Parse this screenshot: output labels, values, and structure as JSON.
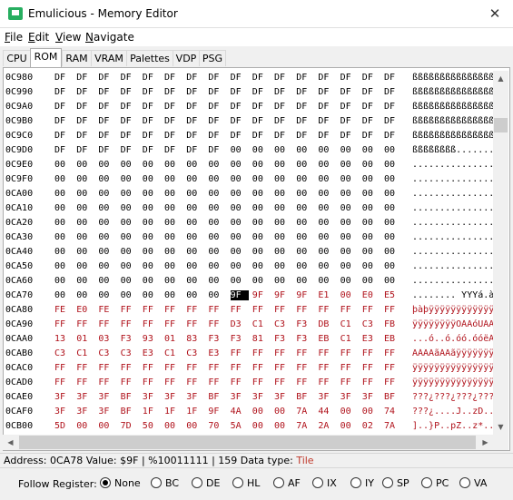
{
  "window": {
    "title": "Emulicious - Memory Editor",
    "close_glyph": "✕"
  },
  "menu": [
    "File",
    "Edit",
    "View",
    "Navigate"
  ],
  "tabs": [
    "CPU",
    "ROM",
    "RAM",
    "VRAM",
    "Palettes",
    "VDP",
    "PSG"
  ],
  "active_tab": "ROM",
  "colors": {
    "modified_byte": "#b0121b",
    "selection": "#000000",
    "accent": "#27ae60"
  },
  "memory": {
    "rows": [
      {
        "addr": "0C980",
        "bytes": [
          "DF",
          "DF",
          "DF",
          "DF",
          "DF",
          "DF",
          "DF",
          "DF",
          "DF",
          "DF",
          "DF",
          "DF",
          "DF",
          "DF",
          "DF",
          "DF"
        ],
        "ascii": "ßßßßßßßßßßßßßßßß",
        "red": false
      },
      {
        "addr": "0C990",
        "bytes": [
          "DF",
          "DF",
          "DF",
          "DF",
          "DF",
          "DF",
          "DF",
          "DF",
          "DF",
          "DF",
          "DF",
          "DF",
          "DF",
          "DF",
          "DF",
          "DF"
        ],
        "ascii": "ßßßßßßßßßßßßßßßß",
        "red": false
      },
      {
        "addr": "0C9A0",
        "bytes": [
          "DF",
          "DF",
          "DF",
          "DF",
          "DF",
          "DF",
          "DF",
          "DF",
          "DF",
          "DF",
          "DF",
          "DF",
          "DF",
          "DF",
          "DF",
          "DF"
        ],
        "ascii": "ßßßßßßßßßßßßßßßß",
        "red": false
      },
      {
        "addr": "0C9B0",
        "bytes": [
          "DF",
          "DF",
          "DF",
          "DF",
          "DF",
          "DF",
          "DF",
          "DF",
          "DF",
          "DF",
          "DF",
          "DF",
          "DF",
          "DF",
          "DF",
          "DF"
        ],
        "ascii": "ßßßßßßßßßßßßßßßß",
        "red": false
      },
      {
        "addr": "0C9C0",
        "bytes": [
          "DF",
          "DF",
          "DF",
          "DF",
          "DF",
          "DF",
          "DF",
          "DF",
          "DF",
          "DF",
          "DF",
          "DF",
          "DF",
          "DF",
          "DF",
          "DF"
        ],
        "ascii": "ßßßßßßßßßßßßßßßß",
        "red": false
      },
      {
        "addr": "0C9D0",
        "bytes": [
          "DF",
          "DF",
          "DF",
          "DF",
          "DF",
          "DF",
          "DF",
          "DF",
          "00",
          "00",
          "00",
          "00",
          "00",
          "00",
          "00",
          "00"
        ],
        "ascii": "ßßßßßßßß........",
        "red": false
      },
      {
        "addr": "0C9E0",
        "bytes": [
          "00",
          "00",
          "00",
          "00",
          "00",
          "00",
          "00",
          "00",
          "00",
          "00",
          "00",
          "00",
          "00",
          "00",
          "00",
          "00"
        ],
        "ascii": "................",
        "red": false
      },
      {
        "addr": "0C9F0",
        "bytes": [
          "00",
          "00",
          "00",
          "00",
          "00",
          "00",
          "00",
          "00",
          "00",
          "00",
          "00",
          "00",
          "00",
          "00",
          "00",
          "00"
        ],
        "ascii": "................",
        "red": false
      },
      {
        "addr": "0CA00",
        "bytes": [
          "00",
          "00",
          "00",
          "00",
          "00",
          "00",
          "00",
          "00",
          "00",
          "00",
          "00",
          "00",
          "00",
          "00",
          "00",
          "00"
        ],
        "ascii": "................",
        "red": false
      },
      {
        "addr": "0CA10",
        "bytes": [
          "00",
          "00",
          "00",
          "00",
          "00",
          "00",
          "00",
          "00",
          "00",
          "00",
          "00",
          "00",
          "00",
          "00",
          "00",
          "00"
        ],
        "ascii": "................",
        "red": false
      },
      {
        "addr": "0CA20",
        "bytes": [
          "00",
          "00",
          "00",
          "00",
          "00",
          "00",
          "00",
          "00",
          "00",
          "00",
          "00",
          "00",
          "00",
          "00",
          "00",
          "00"
        ],
        "ascii": "................",
        "red": false
      },
      {
        "addr": "0CA30",
        "bytes": [
          "00",
          "00",
          "00",
          "00",
          "00",
          "00",
          "00",
          "00",
          "00",
          "00",
          "00",
          "00",
          "00",
          "00",
          "00",
          "00"
        ],
        "ascii": "................",
        "red": false
      },
      {
        "addr": "0CA40",
        "bytes": [
          "00",
          "00",
          "00",
          "00",
          "00",
          "00",
          "00",
          "00",
          "00",
          "00",
          "00",
          "00",
          "00",
          "00",
          "00",
          "00"
        ],
        "ascii": "................",
        "red": false
      },
      {
        "addr": "0CA50",
        "bytes": [
          "00",
          "00",
          "00",
          "00",
          "00",
          "00",
          "00",
          "00",
          "00",
          "00",
          "00",
          "00",
          "00",
          "00",
          "00",
          "00"
        ],
        "ascii": "................",
        "red": false
      },
      {
        "addr": "0CA60",
        "bytes": [
          "00",
          "00",
          "00",
          "00",
          "00",
          "00",
          "00",
          "00",
          "00",
          "00",
          "00",
          "00",
          "00",
          "00",
          "00",
          "00"
        ],
        "ascii": "................",
        "red": false
      },
      {
        "addr": "0CA70",
        "bytes": [
          "00",
          "00",
          "00",
          "00",
          "00",
          "00",
          "00",
          "00",
          "9F",
          "9F",
          "9F",
          "9F",
          "E1",
          "00",
          "E0",
          "E5"
        ],
        "ascii": "........ ŸŸŸá.àå",
        "red": false,
        "red_from": 8,
        "sel_index": 8
      },
      {
        "addr": "0CA80",
        "bytes": [
          "FE",
          "E0",
          "FE",
          "FF",
          "FF",
          "FF",
          "FF",
          "FF",
          "FF",
          "FF",
          "FF",
          "FF",
          "FF",
          "FF",
          "FF",
          "FF"
        ],
        "ascii": "þàþÿÿÿÿÿÿÿÿÿÿÿÿÿ",
        "red": true
      },
      {
        "addr": "0CA90",
        "bytes": [
          "FF",
          "FF",
          "FF",
          "FF",
          "FF",
          "FF",
          "FF",
          "FF",
          "D3",
          "C1",
          "C3",
          "F3",
          "DB",
          "C1",
          "C3",
          "FB"
        ],
        "ascii": "ÿÿÿÿÿÿÿÿÓÁÃóÛÁÃû",
        "red": true
      },
      {
        "addr": "0CAA0",
        "bytes": [
          "13",
          "01",
          "03",
          "F3",
          "93",
          "01",
          "83",
          "F3",
          "F3",
          "81",
          "F3",
          "F3",
          "EB",
          "C1",
          "E3",
          "EB"
        ],
        "ascii": "...ó..ó.óó.óóëÁãë",
        "red": true
      },
      {
        "addr": "0CAB0",
        "bytes": [
          "C3",
          "C1",
          "C3",
          "C3",
          "E3",
          "C1",
          "C3",
          "E3",
          "FF",
          "FF",
          "FF",
          "FF",
          "FF",
          "FF",
          "FF",
          "FF"
        ],
        "ascii": "ÃÁÃÃãÁÃãÿÿÿÿÿÿÿÿ",
        "red": true
      },
      {
        "addr": "0CAC0",
        "bytes": [
          "FF",
          "FF",
          "FF",
          "FF",
          "FF",
          "FF",
          "FF",
          "FF",
          "FF",
          "FF",
          "FF",
          "FF",
          "FF",
          "FF",
          "FF",
          "FF"
        ],
        "ascii": "ÿÿÿÿÿÿÿÿÿÿÿÿÿÿÿÿ",
        "red": true
      },
      {
        "addr": "0CAD0",
        "bytes": [
          "FF",
          "FF",
          "FF",
          "FF",
          "FF",
          "FF",
          "FF",
          "FF",
          "FF",
          "FF",
          "FF",
          "FF",
          "FF",
          "FF",
          "FF",
          "FF"
        ],
        "ascii": "ÿÿÿÿÿÿÿÿÿÿÿÿÿÿÿÿ",
        "red": true
      },
      {
        "addr": "0CAE0",
        "bytes": [
          "3F",
          "3F",
          "3F",
          "BF",
          "3F",
          "3F",
          "3F",
          "BF",
          "3F",
          "3F",
          "3F",
          "BF",
          "3F",
          "3F",
          "3F",
          "BF"
        ],
        "ascii": "???¿???¿???¿???¿",
        "red": true
      },
      {
        "addr": "0CAF0",
        "bytes": [
          "3F",
          "3F",
          "3F",
          "BF",
          "1F",
          "1F",
          "1F",
          "9F",
          "4A",
          "00",
          "00",
          "7A",
          "44",
          "00",
          "00",
          "74"
        ],
        "ascii": "???¿....J..zD..t",
        "red": true
      },
      {
        "addr": "0CB00",
        "bytes": [
          "5D",
          "00",
          "00",
          "7D",
          "50",
          "00",
          "00",
          "70",
          "5A",
          "00",
          "00",
          "7A",
          "2A",
          "00",
          "02",
          "7A"
        ],
        "ascii": "]..}P..pZ..z*..z",
        "red": true
      }
    ]
  },
  "status": {
    "prefix": "Address: 0CA78 Value: $9F | %10011111 | 159 Data type: ",
    "data_type": "Tile"
  },
  "follow": {
    "label": "Follow Register:",
    "options": [
      "None",
      "BC",
      "DE",
      "HL",
      "AF",
      "IX",
      "IY",
      "SP",
      "PC",
      "VA"
    ],
    "selected": "None"
  },
  "scroll_arrows": {
    "up": "▲",
    "down": "▼",
    "left": "◀",
    "right": "▶"
  }
}
